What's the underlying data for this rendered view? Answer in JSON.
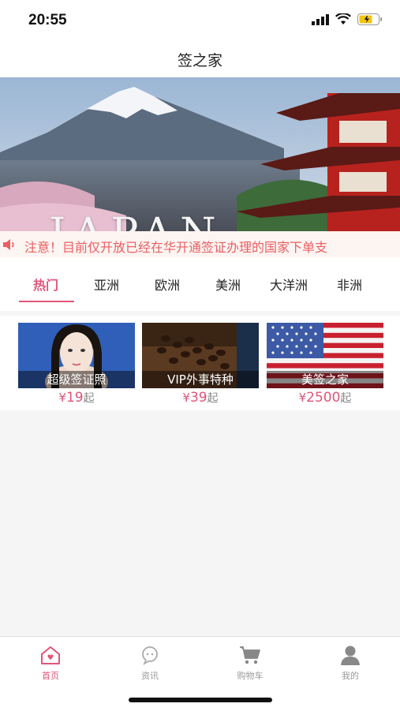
{
  "status_bar": {
    "time": "20:55"
  },
  "nav": {
    "title": "签之家"
  },
  "banner": {
    "text": "JAPAN",
    "page_index": 0,
    "page_count": 1
  },
  "notice": {
    "text": "注意！目前仅开放已经在华开通签证办理的国家下单支"
  },
  "tabs": [
    {
      "label": "热门",
      "active": true
    },
    {
      "label": "亚洲",
      "active": false
    },
    {
      "label": "欧洲",
      "active": false
    },
    {
      "label": "美洲",
      "active": false
    },
    {
      "label": "大洋洲",
      "active": false
    },
    {
      "label": "非洲",
      "active": false
    }
  ],
  "products": [
    {
      "title": "超级签证照",
      "currency": "¥",
      "price": "19",
      "suffix": "起"
    },
    {
      "title": "VIP外事特种",
      "currency": "¥",
      "price": "39",
      "suffix": "起"
    },
    {
      "title": "美签之家",
      "currency": "¥",
      "price": "2500",
      "suffix": "起"
    }
  ],
  "tabbar": [
    {
      "label": "首页",
      "icon": "home-icon",
      "active": true
    },
    {
      "label": "资讯",
      "icon": "chat-icon",
      "active": false
    },
    {
      "label": "购物车",
      "icon": "cart-icon",
      "active": false
    },
    {
      "label": "我的",
      "icon": "user-icon",
      "active": false
    }
  ],
  "colors": {
    "accent": "#e05577",
    "notice_text": "#ea5f63",
    "notice_bg": "#fdf5f2"
  }
}
